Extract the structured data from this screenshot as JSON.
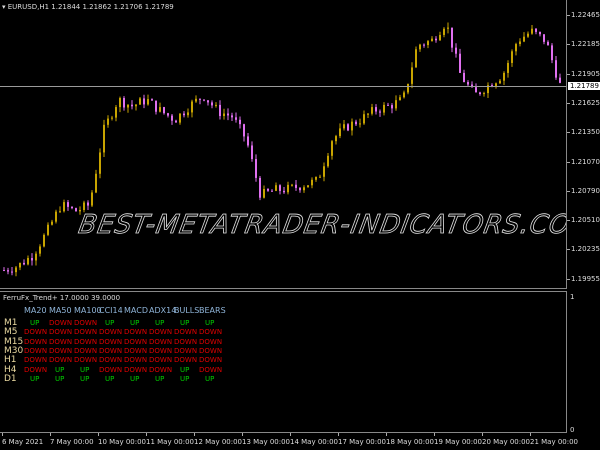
{
  "chart": {
    "symbol_line": "EURUSD,H1  1.21844 1.21862 1.21706 1.21789",
    "current_price": "1.21789",
    "price_labels": [
      "1.22465",
      "1.22185",
      "1.21905",
      "1.21625",
      "1.21350",
      "1.21070",
      "1.20790",
      "1.20510",
      "1.20235",
      "1.19955"
    ],
    "time_labels": [
      "6 May 2021",
      "7 May 00:00",
      "10 May 00:00",
      "11 May 00:00",
      "12 May 00:00",
      "13 May 00:00",
      "14 May 00:00",
      "17 May 00:00",
      "18 May 00:00",
      "19 May 00:00",
      "20 May 00:00",
      "21 May 00:00"
    ],
    "watermark": "BEST-METATRADER-INDICATORS.COM",
    "colors": {
      "bull": "#c8a400",
      "bear": "#e070f0",
      "grid": "#888888"
    }
  },
  "chart_data": {
    "type": "candlestick",
    "title": "EURUSD,H1",
    "ylim": [
      1.19955,
      1.22465
    ],
    "close_path": [
      1.2004,
      1.2008,
      1.2018,
      1.204,
      1.2066,
      1.206,
      1.2066,
      1.2137,
      1.2166,
      1.216,
      1.2166,
      1.2155,
      1.2147,
      1.216,
      1.217,
      1.2155,
      1.215,
      1.2128,
      1.2075,
      1.208,
      1.2081,
      1.2085,
      1.2089,
      1.2128,
      1.214,
      1.2147,
      1.2156,
      1.216,
      1.2166,
      1.2218,
      1.2222,
      1.224,
      1.219,
      1.217,
      1.218,
      1.219,
      1.2222,
      1.2231,
      1.2222,
      1.218
    ]
  },
  "indicator": {
    "title": "FerruFx_Trend+ 17.0000 39.0000",
    "scale_top": "1",
    "scale_bottom": "0",
    "columns": [
      "MA20",
      "MA50",
      "MA100",
      "CCI14",
      "MACD",
      "ADX14",
      "BULLS",
      "BEARS"
    ],
    "rows": [
      {
        "tf": "M1",
        "values": [
          "UP",
          "DOWN",
          "DOWN",
          "UP",
          "UP",
          "UP",
          "UP",
          "UP"
        ]
      },
      {
        "tf": "M5",
        "values": [
          "DOWN",
          "DOWN",
          "DOWN",
          "DOWN",
          "DOWN",
          "DOWN",
          "DOWN",
          "DOWN"
        ]
      },
      {
        "tf": "M15",
        "values": [
          "DOWN",
          "DOWN",
          "DOWN",
          "DOWN",
          "DOWN",
          "DOWN",
          "DOWN",
          "DOWN"
        ]
      },
      {
        "tf": "M30",
        "values": [
          "DOWN",
          "DOWN",
          "DOWN",
          "DOWN",
          "DOWN",
          "DOWN",
          "DOWN",
          "DOWN"
        ]
      },
      {
        "tf": "H1",
        "values": [
          "DOWN",
          "DOWN",
          "DOWN",
          "DOWN",
          "DOWN",
          "DOWN",
          "DOWN",
          "DOWN"
        ]
      },
      {
        "tf": "H4",
        "values": [
          "DOWN",
          "UP",
          "UP",
          "DOWN",
          "DOWN",
          "DOWN",
          "UP",
          "DOWN"
        ]
      },
      {
        "tf": "D1",
        "values": [
          "UP",
          "UP",
          "UP",
          "UP",
          "UP",
          "UP",
          "UP",
          "UP"
        ]
      }
    ]
  }
}
